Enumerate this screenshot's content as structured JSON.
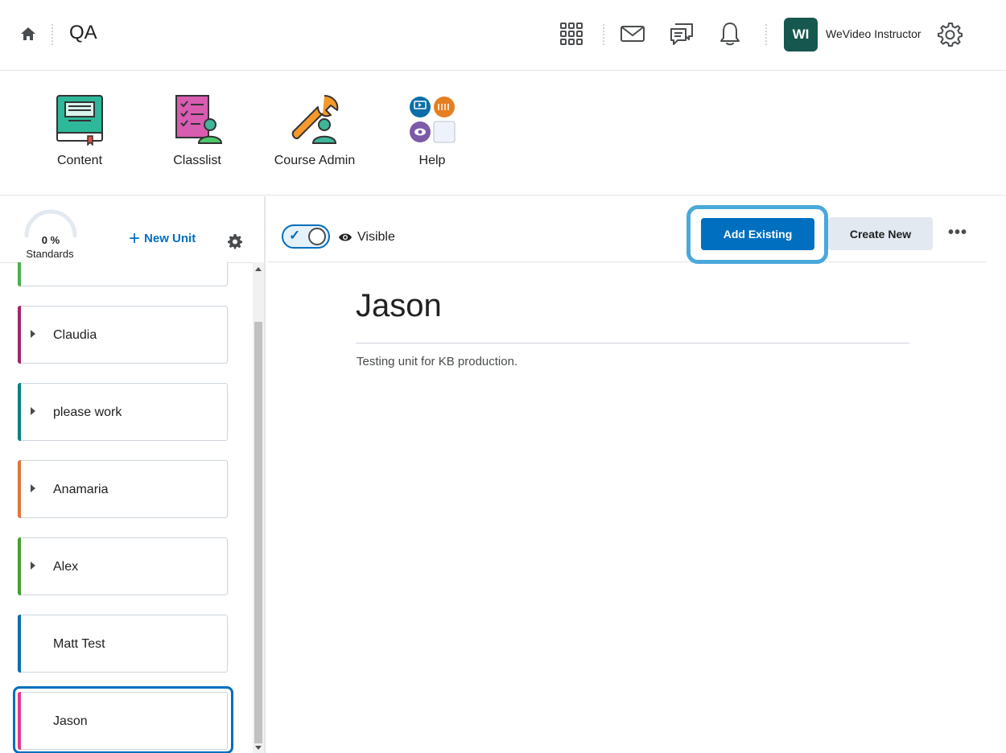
{
  "header": {
    "course_title": "QA",
    "user_initials": "WI",
    "user_name": "WeVideo Instructor",
    "icons": [
      "home-icon",
      "waffle-grid-icon",
      "mail-icon",
      "chat-icon",
      "bell-icon",
      "gear-icon"
    ]
  },
  "navbar": {
    "tools": [
      {
        "label": "Content",
        "icon": "content-book-icon"
      },
      {
        "label": "Classlist",
        "icon": "classlist-icon"
      },
      {
        "label": "Course Admin",
        "icon": "wrench-person-icon"
      },
      {
        "label": "Help",
        "icon": "help-grid-icon"
      }
    ]
  },
  "sidebar": {
    "progress_label": "0 %",
    "progress_value": 0,
    "standards_label": "Standards",
    "new_unit_label": "New Unit",
    "units": [
      {
        "name": "",
        "color": "#4caf50",
        "has_children": false
      },
      {
        "name": "Claudia",
        "color": "#a3256b",
        "has_children": true
      },
      {
        "name": "please work",
        "color": "#00827f",
        "has_children": true
      },
      {
        "name": "Anamaria",
        "color": "#e0763c",
        "has_children": true
      },
      {
        "name": "Alex",
        "color": "#46a12f",
        "has_children": true
      },
      {
        "name": "Matt Test",
        "color": "#0a6fa8",
        "has_children": false
      },
      {
        "name": "Jason",
        "color": "#e6378c",
        "has_children": false,
        "selected": true
      }
    ]
  },
  "toolbar": {
    "visibility_label": "Visible",
    "visibility_on": true,
    "add_existing_label": "Add Existing",
    "create_new_label": "Create New",
    "more_label": "•••"
  },
  "content": {
    "unit_title": "Jason",
    "unit_description": "Testing unit for KB production."
  },
  "colors": {
    "primary": "#006fbf",
    "focus_ring": "#4aa8db",
    "avatar": "#16574f"
  }
}
